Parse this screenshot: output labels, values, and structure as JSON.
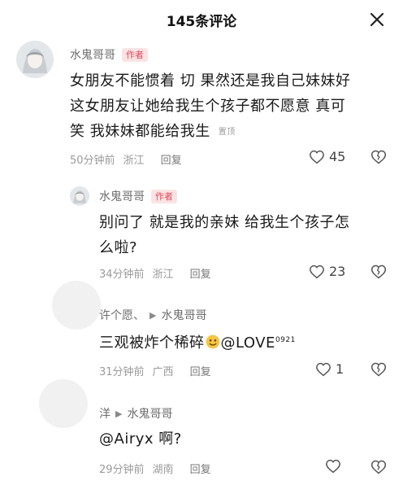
{
  "header": {
    "title": "145条评论"
  },
  "comments": [
    {
      "author": "水鬼哥哥",
      "badge": "作者",
      "lines": [
        "女朋友不能惯着 切 果然还是我自己妹妹好",
        "这女朋友让她给我生个孩子都不愿意 真可",
        "笑 我妹妹都能给我生"
      ],
      "pinned": "置顶",
      "time": "50分钟前",
      "location": "浙江",
      "reply": "回复",
      "likes": "45"
    },
    {
      "author": "水鬼哥哥",
      "badge": "作者",
      "lines": [
        "别问了 就是我的亲妹 给我生个孩子怎",
        "么啦?"
      ],
      "time": "34分钟前",
      "location": "浙江",
      "reply": "回复",
      "likes": "23"
    },
    {
      "author": "许个愿、",
      "reply_to": "水鬼哥哥",
      "text_before": "三观被炸个稀碎",
      "mention": "@LOVE",
      "mention_sup": "0921",
      "time": "31分钟前",
      "location": "广西",
      "reply": "回复",
      "likes": "1"
    },
    {
      "author": "洋",
      "reply_to": "水鬼哥哥",
      "text": "@Airyx 啊?",
      "time": "29分钟前",
      "location": "湖南",
      "reply": "回复"
    }
  ]
}
